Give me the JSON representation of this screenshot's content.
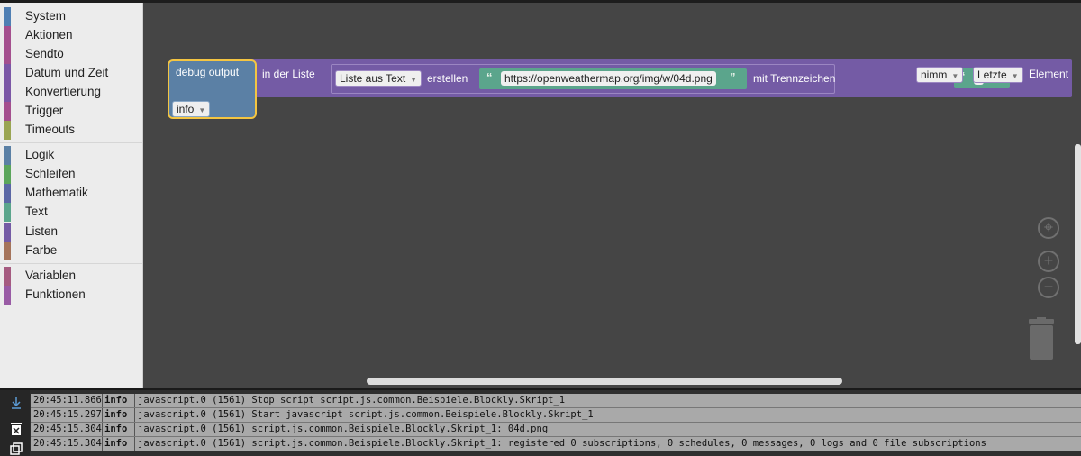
{
  "toolbox": {
    "categories": [
      {
        "label": "System",
        "color": "#4f7fb3"
      },
      {
        "label": "Aktionen",
        "color": "#a44f8e"
      },
      {
        "label": "Sendto",
        "color": "#a44f8e"
      },
      {
        "label": "Datum und Zeit",
        "color": "#7b57a6"
      },
      {
        "label": "Konvertierung",
        "color": "#7b57a6"
      },
      {
        "label": "Trigger",
        "color": "#a44f8e"
      },
      {
        "label": "Timeouts",
        "color": "#9aa552"
      },
      {
        "label": "Logik",
        "color": "#5b80a5"
      },
      {
        "label": "Schleifen",
        "color": "#5ba55b"
      },
      {
        "label": "Mathematik",
        "color": "#5b67a5"
      },
      {
        "label": "Text",
        "color": "#5ba58c"
      },
      {
        "label": "Listen",
        "color": "#745ba5"
      },
      {
        "label": "Farbe",
        "color": "#a5745b"
      },
      {
        "label": "Variablen",
        "color": "#a55b80"
      },
      {
        "label": "Funktionen",
        "color": "#995ba5"
      }
    ]
  },
  "blocks": {
    "debug": {
      "label": "debug output",
      "level": "info",
      "color": "#5b80a5"
    },
    "list_get": {
      "label": "in der Liste",
      "mode": "nimm",
      "where": "Letzte",
      "suffix": "Element",
      "color": "#745ba5"
    },
    "split": {
      "mode": "Liste aus Text",
      "verb": "erstellen",
      "delimiter_label": "mit Trennzeichen"
    },
    "text_url": {
      "value": "https://openweathermap.org/img/w/04d.png",
      "open_quote": "“",
      "close_quote": "”"
    },
    "text_delim": {
      "value": "/",
      "open_quote": "“",
      "close_quote": "”"
    }
  },
  "controls": {
    "center_icon": "crosshair-icon",
    "zoom_in_icon": "plus-icon",
    "zoom_out_icon": "minus-icon",
    "trash_icon": "trash-icon"
  },
  "log": {
    "side_icons": [
      "download-arrow-icon",
      "clear-log-icon",
      "copy-icon"
    ],
    "rows": [
      {
        "time": "20:45:11.866",
        "severity": "info",
        "message": "javascript.0 (1561) Stop script script.js.common.Beispiele.Blockly.Skript_1"
      },
      {
        "time": "20:45:15.297",
        "severity": "info",
        "message": "javascript.0 (1561) Start javascript script.js.common.Beispiele.Blockly.Skript_1"
      },
      {
        "time": "20:45:15.304",
        "severity": "info",
        "message": "javascript.0 (1561) script.js.common.Beispiele.Blockly.Skript_1: 04d.png"
      },
      {
        "time": "20:45:15.304",
        "severity": "info",
        "message": "javascript.0 (1561) script.js.common.Beispiele.Blockly.Skript_1: registered 0 subscriptions, 0 schedules, 0 messages, 0 logs and 0 file subscriptions"
      }
    ]
  }
}
